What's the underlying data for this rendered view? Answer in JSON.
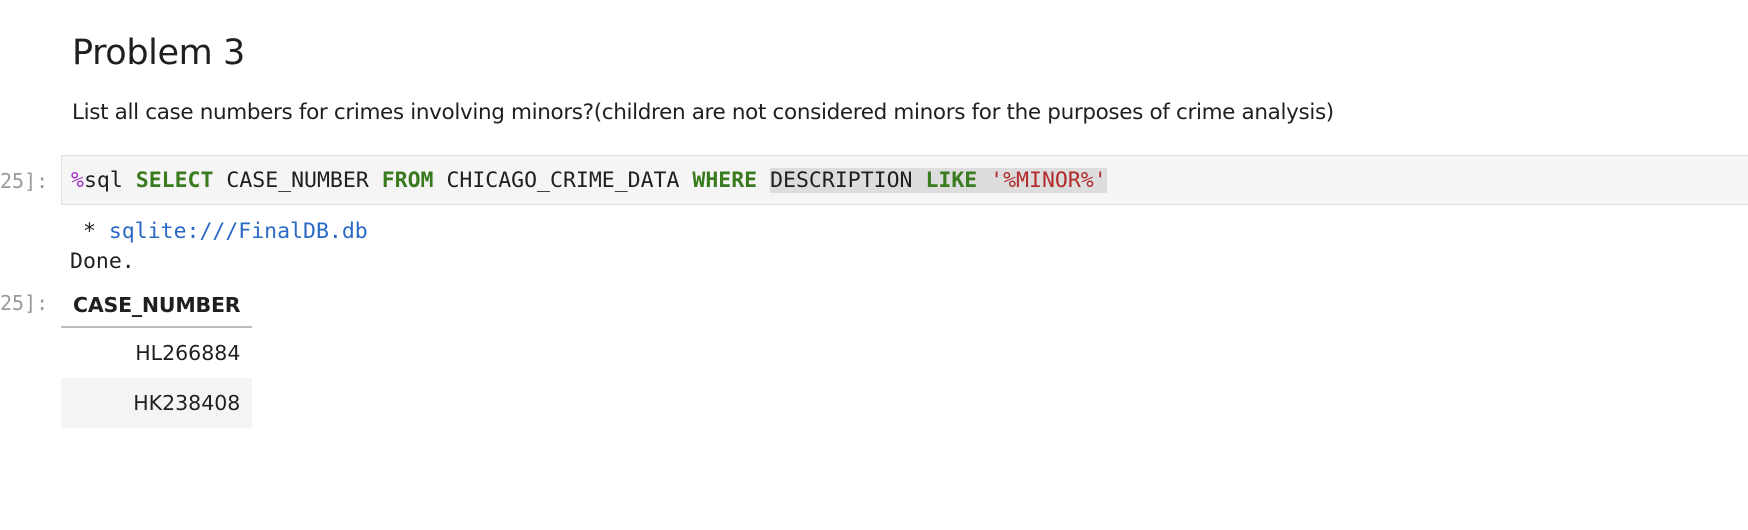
{
  "markdown": {
    "heading": "Problem 3",
    "description": "List all case numbers for crimes involving minors?(children are not considered minors for the purposes of crime analysis)"
  },
  "code_cell": {
    "prompt": "25]:",
    "tokens": {
      "magic_symbol": "%",
      "magic_name": "sql",
      "select": "SELECT",
      "column": "CASE_NUMBER",
      "from": "FROM",
      "table": "CHICAGO_CRIME_DATA",
      "where": "WHERE",
      "field": "DESCRIPTION",
      "like": "LIKE",
      "pattern": "'%MINOR%'"
    }
  },
  "output": {
    "prompt": "25]:",
    "bullet": " * ",
    "connection": "sqlite:///FinalDB.db",
    "status": "Done.",
    "table": {
      "header": "CASE_NUMBER",
      "rows": [
        "HL266884",
        "HK238408"
      ]
    }
  },
  "colors": {
    "keyword": "#3a7b1f",
    "magic": "#a333c8",
    "string": "#b22a2a",
    "link": "#2a69c4",
    "cell_background": "#f5f5f5"
  }
}
